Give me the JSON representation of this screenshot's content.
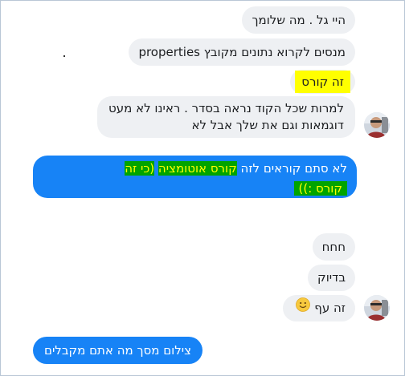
{
  "messages": {
    "m1": "היי גל . מה שלומך",
    "m2": "מנסים לקרוא נתונים מקובץ properties",
    "m3": "זה קורס",
    "m4_line1": "למרות שכל הקוד נראה בסדר . ראינו לא מעט",
    "m4_line2": "דוגמאות וגם את שלך אבל לא",
    "m5_line1_a": "לא סתם קוראים לזה ",
    "m5_line1_b": "קורס אוטומציה",
    "m5_line1_c": " ",
    "m5_line1_d": "(כי זה",
    "m5_line2": "קורס :))",
    "m6": "חחח",
    "m7": "בדיוק",
    "m8": "זה עף",
    "m9": "צילום מסך מה אתם מקבלים"
  },
  "colors": {
    "incoming_bubble": "#eef0f3",
    "outgoing_bubble": "#1783f6",
    "highlight_yellow": "#ffff00",
    "highlight_green": "#00a400"
  },
  "icons": {
    "avatar": "user-avatar",
    "emoji": "smiley-emoji"
  }
}
